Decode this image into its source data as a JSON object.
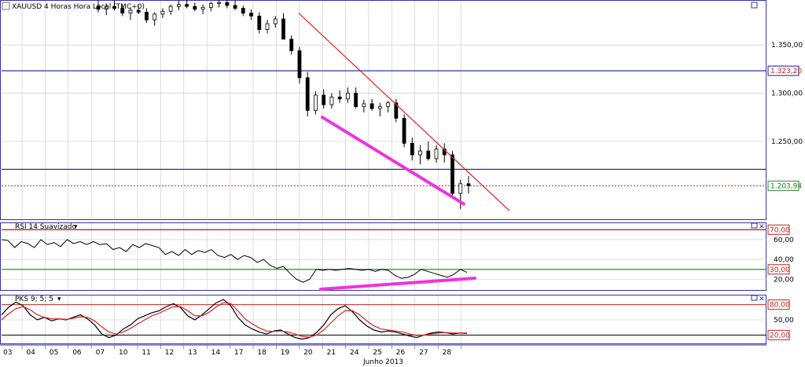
{
  "window": {
    "main_title": "XAUUSD 4 Horas Hora Local (TMC+0)",
    "rsi_title": "RSI 14 Suavizado",
    "pks_title": "PKS 9; 5; 5",
    "dropdown_glyph": "▾",
    "month_label": "Junho 2013"
  },
  "colors": {
    "hline_blue": "#1a1aa0",
    "trend_red": "#e02020",
    "highlight_magenta": "#ee33dd",
    "grid": "#c8c8c8",
    "panel_border": "#3333aa",
    "rsi_70": "#cc2222",
    "rsi_30": "#229922",
    "pks_signal": "#dd2222"
  },
  "chart_data": [
    {
      "type": "candlestick",
      "title": "XAUUSD 4 Horas Hora Local (TMC+0)",
      "x_dates": [
        "03",
        "04",
        "05",
        "06",
        "07",
        "10",
        "11",
        "12",
        "13",
        "14",
        "17",
        "18",
        "19",
        "20",
        "21",
        "24",
        "25",
        "26",
        "27",
        "28"
      ],
      "y_ticks": [
        "1.350,00",
        "1.300,00",
        "1.250,00"
      ],
      "ylim": [
        1170,
        1395
      ],
      "hlines": [
        1323.2,
        1221
      ],
      "last_price": 1203.94,
      "hline_label": "1.323,20",
      "last_label": "1.203,94",
      "trendline_upper": [
        [
          0,
          1383
        ],
        [
          21.0,
          1178
        ]
      ],
      "support_line": [
        [
          13.5,
          1275
        ],
        [
          19.0,
          1185
        ]
      ],
      "bars": [
        [
          1390,
          1396,
          1384,
          1387
        ],
        [
          1387,
          1393,
          1381,
          1390
        ],
        [
          1390,
          1396,
          1386,
          1388
        ],
        [
          1388,
          1392,
          1380,
          1383
        ],
        [
          1383,
          1389,
          1376,
          1386
        ],
        [
          1386,
          1391,
          1382,
          1384
        ],
        [
          1384,
          1388,
          1373,
          1376
        ],
        [
          1376,
          1384,
          1370,
          1382
        ],
        [
          1382,
          1388,
          1378,
          1385
        ],
        [
          1385,
          1392,
          1381,
          1390
        ],
        [
          1390,
          1396,
          1386,
          1392
        ],
        [
          1392,
          1397,
          1388,
          1390
        ],
        [
          1390,
          1394,
          1385,
          1387
        ],
        [
          1387,
          1392,
          1382,
          1389
        ],
        [
          1389,
          1395,
          1385,
          1393
        ],
        [
          1393,
          1398,
          1389,
          1394
        ],
        [
          1394,
          1397,
          1388,
          1391
        ],
        [
          1391,
          1396,
          1386,
          1388
        ],
        [
          1388,
          1391,
          1380,
          1383
        ],
        [
          1383,
          1387,
          1376,
          1380
        ],
        [
          1380,
          1384,
          1362,
          1366
        ],
        [
          1366,
          1376,
          1362,
          1372
        ],
        [
          1372,
          1380,
          1368,
          1377
        ],
        [
          1377,
          1383,
          1368,
          1356
        ],
        [
          1356,
          1360,
          1340,
          1344
        ],
        [
          1344,
          1348,
          1310,
          1316
        ],
        [
          1316,
          1322,
          1276,
          1282
        ],
        [
          1282,
          1302,
          1278,
          1298
        ],
        [
          1298,
          1304,
          1284,
          1288
        ],
        [
          1288,
          1300,
          1284,
          1296
        ],
        [
          1296,
          1303,
          1290,
          1294
        ],
        [
          1294,
          1306,
          1290,
          1300
        ],
        [
          1300,
          1306,
          1284,
          1286
        ],
        [
          1286,
          1293,
          1280,
          1289
        ],
        [
          1289,
          1294,
          1282,
          1284
        ],
        [
          1284,
          1290,
          1276,
          1286
        ],
        [
          1286,
          1292,
          1280,
          1290
        ],
        [
          1290,
          1294,
          1270,
          1274
        ],
        [
          1274,
          1278,
          1244,
          1248
        ],
        [
          1248,
          1254,
          1230,
          1236
        ],
        [
          1236,
          1246,
          1226,
          1240
        ],
        [
          1240,
          1250,
          1230,
          1232
        ],
        [
          1232,
          1246,
          1228,
          1242
        ],
        [
          1242,
          1248,
          1228,
          1236
        ],
        [
          1236,
          1240,
          1192,
          1196
        ],
        [
          1196,
          1210,
          1180,
          1206
        ],
        [
          1206,
          1214,
          1196,
          1204
        ]
      ]
    },
    {
      "type": "line",
      "title": "RSI 14 Suavizado",
      "ylim": [
        10,
        75
      ],
      "y_ticks": [
        "70,00",
        "60,00",
        "40,00",
        "30,00",
        "20,00"
      ],
      "levels": [
        70,
        30
      ],
      "support_line": [
        [
          13.3,
          14
        ],
        [
          20.4,
          22
        ]
      ],
      "values": [
        60,
        59,
        52,
        58,
        56,
        52,
        60,
        55,
        57,
        53,
        60,
        56,
        58,
        55,
        58,
        55,
        56,
        50,
        52,
        48,
        55,
        52,
        56,
        54,
        52,
        45,
        48,
        44,
        50,
        45,
        49,
        47,
        50,
        44,
        42,
        45,
        40,
        44,
        42,
        37,
        40,
        34,
        31,
        33,
        26,
        20,
        17,
        20,
        30,
        29,
        30,
        29,
        30,
        31,
        30,
        29,
        30,
        28,
        30,
        29,
        24,
        21,
        22,
        25,
        30,
        28,
        26,
        24,
        22,
        25,
        30,
        27
      ]
    },
    {
      "type": "line",
      "title": "PKS 9; 5; 5",
      "ylim": [
        5,
        95
      ],
      "y_ticks": [
        "80,00",
        "50,00",
        "20,00"
      ],
      "levels": [
        80,
        20
      ],
      "series": [
        {
          "values": [
            60,
            75,
            85,
            78,
            60,
            50,
            55,
            48,
            52,
            50,
            55,
            60,
            52,
            40,
            22,
            15,
            20,
            32,
            40,
            52,
            58,
            64,
            68,
            76,
            82,
            74,
            58,
            50,
            60,
            72,
            84,
            90,
            78,
            55,
            40,
            32,
            26,
            22,
            28,
            30,
            22,
            15,
            12,
            15,
            25,
            40,
            60,
            72,
            78,
            66,
            50,
            38,
            30,
            26,
            28,
            26,
            22,
            18,
            15,
            20,
            24,
            26,
            25,
            22,
            24,
            23
          ]
        },
        {
          "values": [
            50,
            62,
            72,
            76,
            70,
            60,
            55,
            52,
            52,
            51,
            53,
            56,
            55,
            48,
            36,
            26,
            22,
            26,
            33,
            42,
            50,
            58,
            63,
            70,
            76,
            76,
            68,
            58,
            58,
            65,
            76,
            84,
            82,
            68,
            52,
            42,
            34,
            28,
            27,
            28,
            26,
            22,
            17,
            16,
            20,
            30,
            44,
            58,
            68,
            68,
            60,
            48,
            38,
            32,
            30,
            28,
            26,
            22,
            19,
            20,
            22,
            24,
            25,
            24,
            24,
            24
          ]
        }
      ]
    }
  ]
}
